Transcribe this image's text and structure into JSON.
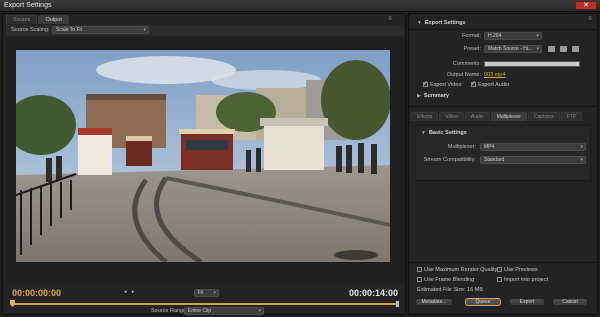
{
  "window": {
    "title": "Export Settings",
    "close_glyph": "✕"
  },
  "source_tabs": [
    "Source",
    "Output"
  ],
  "panel_menu_glyph": "≡",
  "source_scaling": {
    "label": "Source Scaling:",
    "value": "Scale To Fit"
  },
  "timeline": {
    "in_timecode": "00:00:00:00",
    "out_timecode": "00:00:14:00",
    "marker_glyphs": "◂ ▸",
    "zoom": "Fit",
    "source_range_label": "Source Range:",
    "source_range_value": "Entire Clip",
    "playhead_fraction": 0
  },
  "export_settings": {
    "header": "Export Settings",
    "format_label": "Format:",
    "format_value": "H.264",
    "preset_label": "Preset:",
    "preset_value": "Match Source - Hi...",
    "comments_label": "Comments:",
    "output_name_label": "Output Name:",
    "output_name_value": "003.mp4",
    "export_video_label": "Export Video",
    "export_video_checked": true,
    "export_audio_label": "Export Audio",
    "export_audio_checked": true,
    "summary_label": "Summary"
  },
  "settings_tabs": [
    "Effects",
    "Video",
    "Audio",
    "Multiplexer",
    "Captions",
    "FTP"
  ],
  "active_settings_tab": "Multiplexer",
  "basic_settings": {
    "header": "Basic Settings",
    "multiplexer_label": "Multiplexer:",
    "multiplexer_value": "MP4",
    "stream_label": "Stream Compatibility:",
    "stream_value": "Standard"
  },
  "render_options": {
    "max_render_quality": "Use Maximum Render Quality",
    "use_previews": "Use Previews",
    "frame_blending": "Use Frame Blending",
    "import_into_project": "Import into project",
    "file_size_label": "Estimated File Size:",
    "file_size_value": "16 MB"
  },
  "buttons": {
    "metadata": "Metadata...",
    "queue": "Queue",
    "export": "Export",
    "cancel": "Cancel"
  },
  "colors": {
    "accent": "#e2a93a",
    "background": "#1e1e1e",
    "panel": "#232323"
  },
  "icons": [
    "save-preset-icon",
    "import-preset-icon",
    "delete-preset-icon",
    "panel-menu-icon",
    "dropdown-arrow-icon"
  ]
}
